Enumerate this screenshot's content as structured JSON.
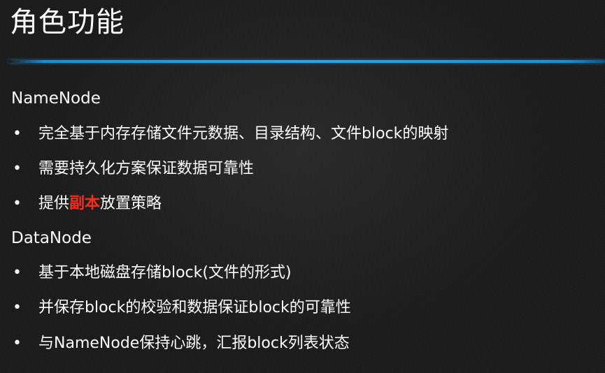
{
  "slide": {
    "title": "角色功能",
    "accent_color": "#1a8fd8",
    "highlight_color": "#ff2a1a",
    "sections": [
      {
        "heading": "NameNode",
        "bullets": [
          {
            "text": "完全基于内存存储文件元数据、目录结构、文件block的映射"
          },
          {
            "text": "需要持久化方案保证数据可靠性"
          },
          {
            "before": "提供",
            "highlight": "副本",
            "after": "放置策略"
          }
        ]
      },
      {
        "heading": "DataNode",
        "bullets": [
          {
            "text": "基于本地磁盘存储block(文件的形式)"
          },
          {
            "text": "并保存block的校验和数据保证block的可靠性"
          },
          {
            "text": "与NameNode保持心跳，汇报block列表状态"
          }
        ]
      }
    ],
    "bullet_symbol": "•"
  }
}
